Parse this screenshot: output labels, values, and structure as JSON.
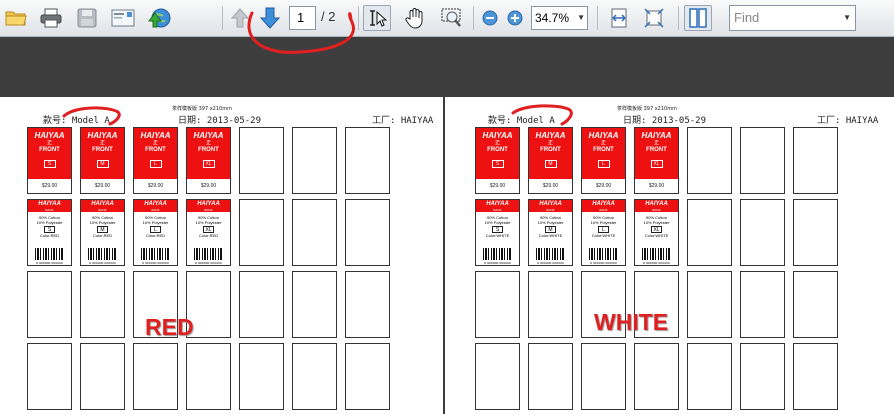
{
  "toolbar": {
    "page_current": "1",
    "page_total": "/ 2",
    "zoom": "34.7%",
    "find_placeholder": "Find",
    "icons": [
      "open-folder-icon",
      "print-icon",
      "save-icon",
      "email-icon",
      "collaborate-icon",
      "previous-page-icon",
      "next-page-icon",
      "select-text-icon",
      "hand-tool-icon",
      "marquee-zoom-icon",
      "zoom-out-icon",
      "zoom-in-icon",
      "fit-width-icon",
      "fit-page-icon",
      "two-page-view-icon"
    ]
  },
  "pages": [
    {
      "title": "茶样模板版 397 x210mm",
      "model": "款号: Model A",
      "date": "日期: 2013-05-29",
      "factory": "工厂: HAIYAA",
      "label": "RED",
      "color_text": "Color:RED"
    },
    {
      "title": "茶样模板版 397 x210mm",
      "model": "款号: Model A",
      "date": "日期: 2013-05-29",
      "factory": "工厂: HAIYAA",
      "label": "WHITE",
      "color_text": "Color:WHITE"
    }
  ],
  "tag": {
    "brand": "HAIYAA",
    "zheng": "正",
    "front": "FRONT",
    "sizes": [
      "S",
      "M",
      "L",
      "XL"
    ],
    "price": "$29.00",
    "back_sub": "BANK",
    "composition1": "90% Cotton",
    "composition2": "10% Polyester",
    "barcode_number": "6 900000 000000"
  },
  "colors": {
    "tag_red": "#ee1111",
    "annotation_red": "#e02020",
    "canvas": "#3d3d3d"
  }
}
